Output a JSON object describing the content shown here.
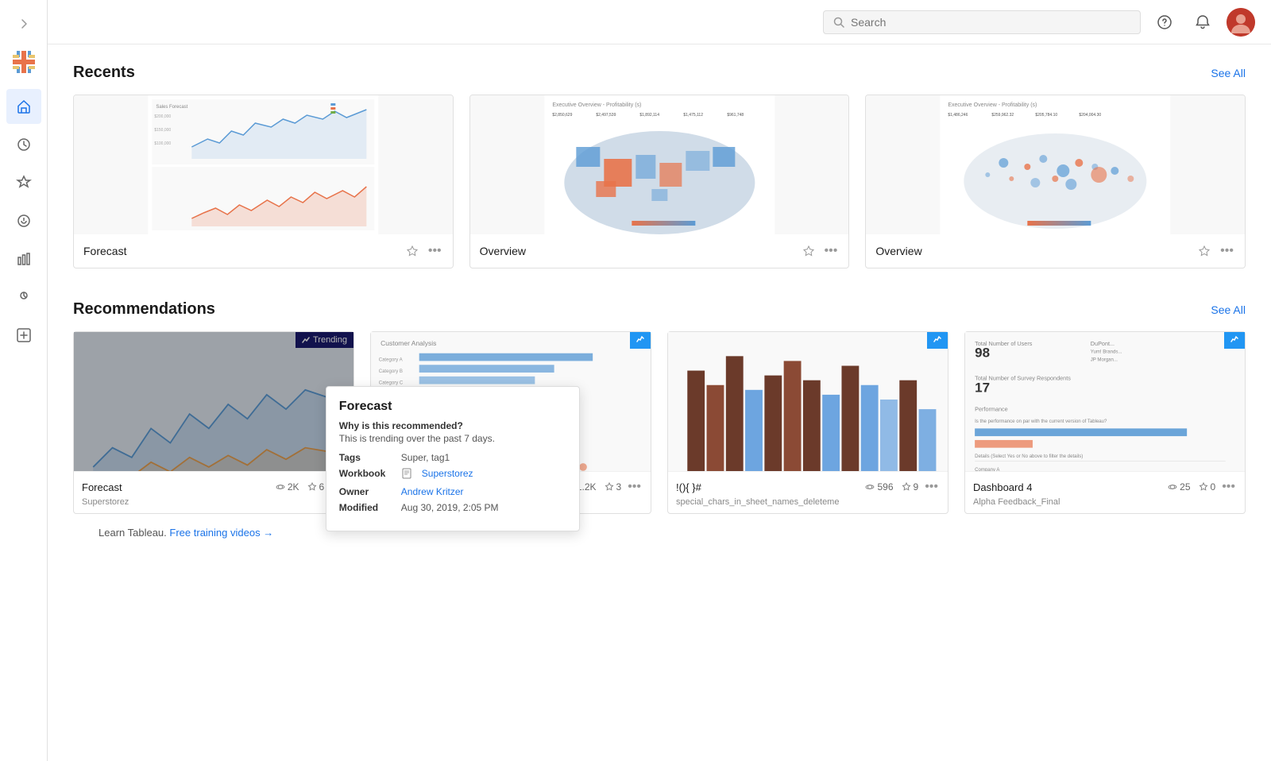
{
  "sidebar": {
    "expand_icon": "›",
    "nav_items": [
      {
        "id": "home",
        "icon": "⌂",
        "label": "Home",
        "active": true
      },
      {
        "id": "recents",
        "icon": "◷",
        "label": "Recents",
        "active": false
      },
      {
        "id": "favorites",
        "icon": "☆",
        "label": "Favorites",
        "active": false
      },
      {
        "id": "history",
        "icon": "↺",
        "label": "History",
        "active": false
      },
      {
        "id": "analytics",
        "icon": "⬜",
        "label": "Analytics",
        "active": false
      },
      {
        "id": "bulb",
        "icon": "💡",
        "label": "Recommendations",
        "active": false
      },
      {
        "id": "shared",
        "icon": "⬛",
        "label": "Shared",
        "active": false
      }
    ]
  },
  "header": {
    "search_placeholder": "Search"
  },
  "recents": {
    "title": "Recents",
    "see_all_label": "See All",
    "cards": [
      {
        "id": "forecast",
        "title": "Forecast"
      },
      {
        "id": "overview1",
        "title": "Overview"
      },
      {
        "id": "overview2",
        "title": "Overview"
      }
    ]
  },
  "recommendations": {
    "title": "Recommendations",
    "see_all_label": "See All",
    "cards": [
      {
        "id": "forecast-rec",
        "title": "Forecast",
        "owner": "Superstorez",
        "views": "2K",
        "favorites": "6",
        "badge": "Trending",
        "badge_type": "trending"
      },
      {
        "id": "exclamation",
        "title": "!(){ }#",
        "owner": "special_chars_in_sheet_names_deleteme",
        "views": "596",
        "favorites": "9",
        "badge_type": "chart"
      },
      {
        "id": "dashboard4",
        "title": "Dashboard 4",
        "owner": "Alpha Feedback_Final",
        "views": "25",
        "favorites": "0",
        "badge_type": "chart"
      }
    ]
  },
  "tooltip": {
    "title": "Forecast",
    "why_label": "Why is this recommended?",
    "why_desc": "This is trending over the past 7 days.",
    "tags_label": "Tags",
    "tags_value": "Super, tag1",
    "workbook_label": "Workbook",
    "workbook_value": "Superstorez",
    "owner_label": "Owner",
    "owner_value": "Andrew Kritzer",
    "modified_label": "Modified",
    "modified_value": "Aug 30, 2019, 2:05 PM"
  },
  "footer": {
    "learn_text": "Learn Tableau.",
    "link_text": "Free training videos",
    "arrow": "→"
  }
}
